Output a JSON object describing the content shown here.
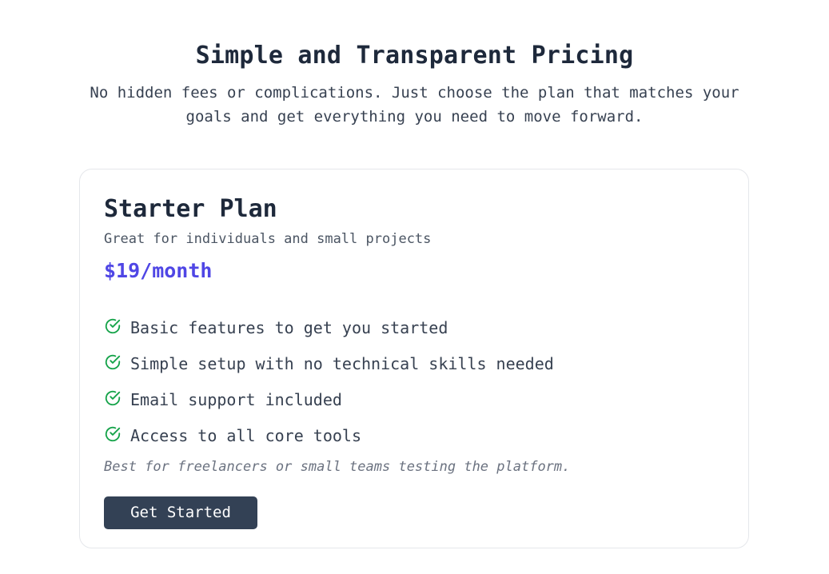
{
  "header": {
    "title": "Simple and Transparent Pricing",
    "subtitle": "No hidden fees or complications. Just choose the plan that matches your goals and get everything you need to move forward."
  },
  "plan": {
    "name": "Starter Plan",
    "description": "Great for individuals and small projects",
    "price": "$19/month",
    "features": [
      {
        "icon": "check-circle-icon",
        "text": "Basic features to get you started"
      },
      {
        "icon": "check-circle-icon",
        "text": "Simple setup with no technical skills needed"
      },
      {
        "icon": "check-circle-icon",
        "text": "Email support included"
      },
      {
        "icon": "check-circle-icon",
        "text": "Access to all core tools"
      }
    ],
    "note": "Best for freelancers or small teams testing the platform.",
    "cta_label": "Get Started"
  },
  "colors": {
    "accent": "#4f46e5",
    "check": "#16a34a",
    "button": "#334155",
    "heading": "#1e293b"
  }
}
